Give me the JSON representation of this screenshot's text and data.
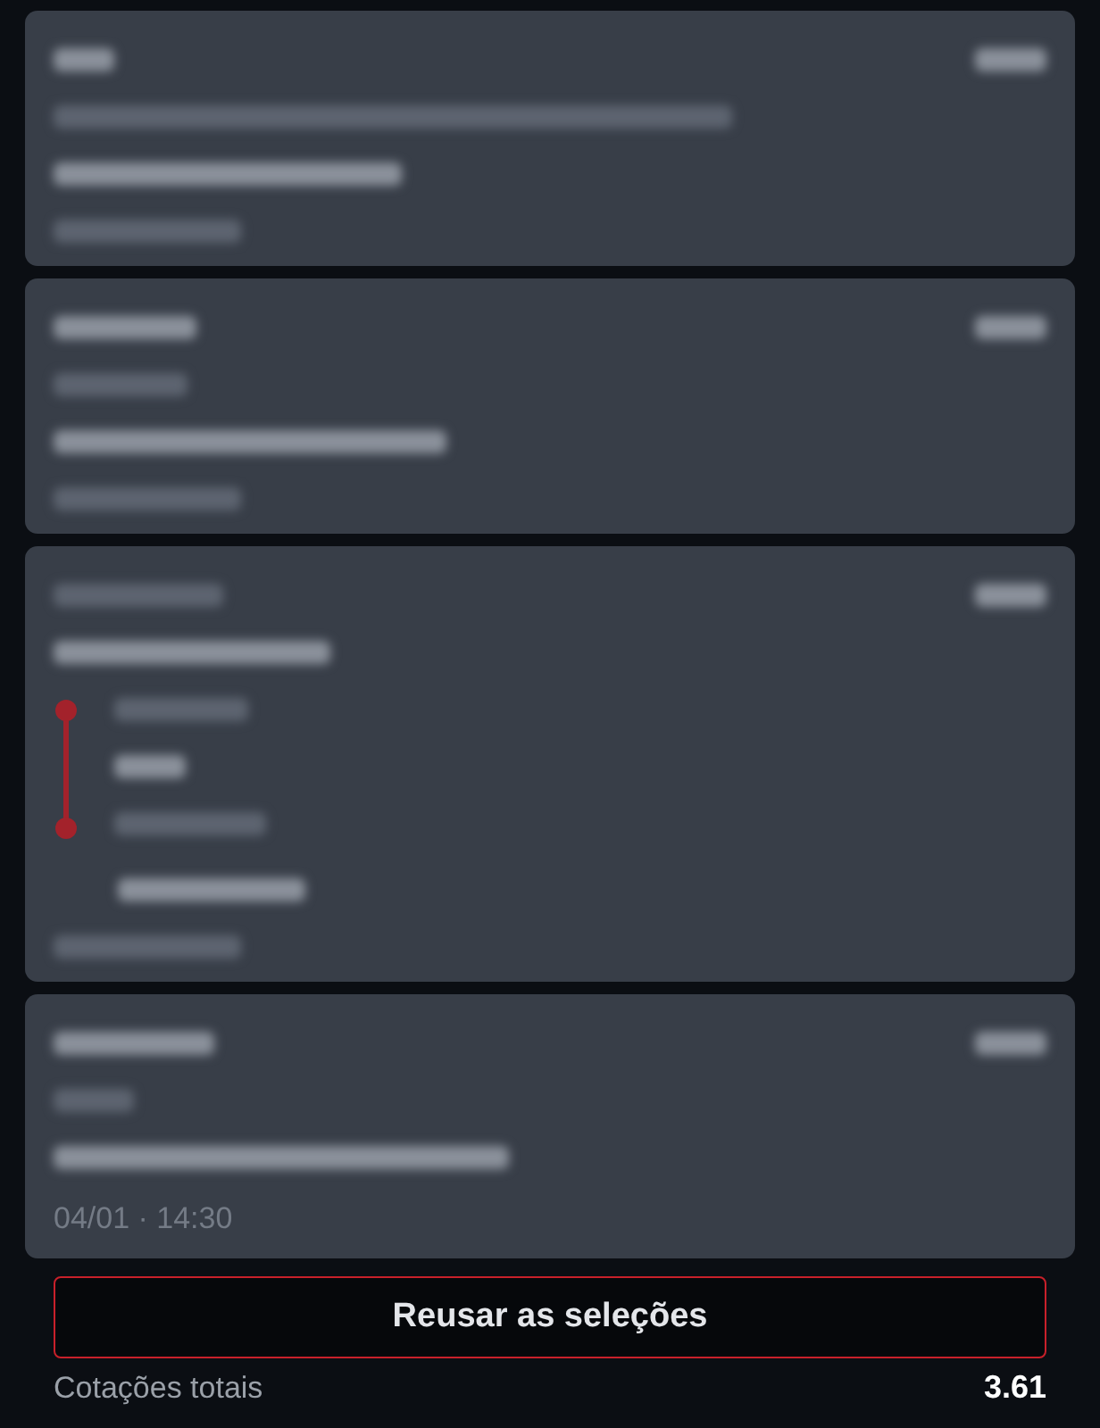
{
  "cards": [
    {
      "kind": "plain"
    },
    {
      "kind": "plain"
    },
    {
      "kind": "timeline"
    },
    {
      "kind": "plain",
      "date": "04/01 · 14:30"
    }
  ],
  "reuse_button": "Reusar as seleções",
  "total": {
    "label": "Cotações totais",
    "value": "3.61"
  }
}
